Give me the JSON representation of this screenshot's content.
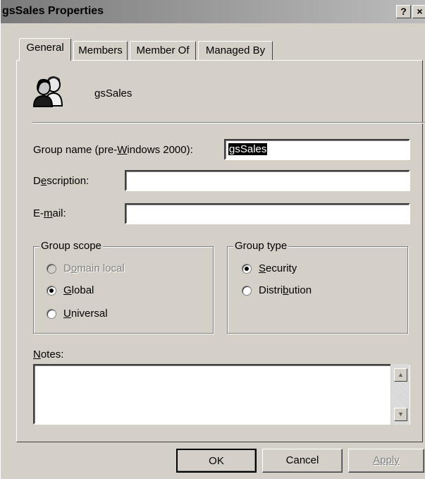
{
  "window": {
    "title": "gsSales Properties",
    "help_label": "?",
    "close_label": "×"
  },
  "tabs": [
    {
      "label": "General",
      "active": true
    },
    {
      "label": "Members",
      "active": false
    },
    {
      "label": "Member Of",
      "active": false
    },
    {
      "label": "Managed By",
      "active": false
    }
  ],
  "general": {
    "group_display_name": "gsSales",
    "group_icon": "group-users-icon",
    "group_name_label_pre": "Group name (pre-",
    "group_name_label_u": "W",
    "group_name_label_post": "indows 2000):",
    "group_name_value": "gsSales",
    "description_label_pre": "D",
    "description_label_u": "e",
    "description_label_post": "scription:",
    "description_value": "",
    "email_label_pre": "E-",
    "email_label_u": "m",
    "email_label_post": "ail:",
    "email_value": "",
    "group_scope": {
      "title": "Group scope",
      "options": [
        {
          "pre": "D",
          "u": "o",
          "post": "main local",
          "checked": false,
          "enabled": false
        },
        {
          "pre": "",
          "u": "G",
          "post": "lobal",
          "checked": true,
          "enabled": true
        },
        {
          "pre": "",
          "u": "U",
          "post": "niversal",
          "checked": false,
          "enabled": true
        }
      ]
    },
    "group_type": {
      "title": "Group type",
      "options": [
        {
          "pre": "",
          "u": "S",
          "post": "ecurity",
          "checked": true,
          "enabled": true
        },
        {
          "pre": "Distri",
          "u": "b",
          "post": "ution",
          "checked": false,
          "enabled": true
        }
      ]
    },
    "notes_label_u": "N",
    "notes_label_post": "otes:",
    "notes_value": ""
  },
  "buttons": {
    "ok": "OK",
    "cancel": "Cancel",
    "apply": "Apply"
  },
  "colors": {
    "dialog_bg": "#d4d0c8",
    "titlebar_start": "#7a7a7a",
    "titlebar_end": "#bcbcbc",
    "disabled_text": "#808080"
  }
}
